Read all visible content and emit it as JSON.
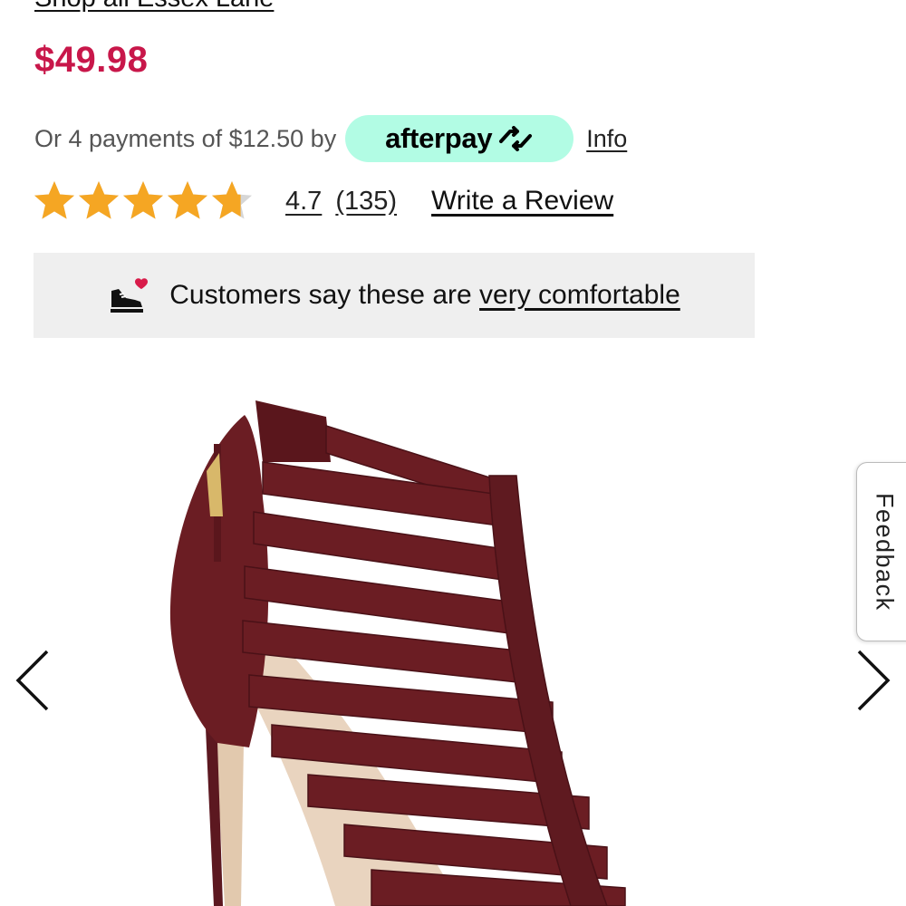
{
  "brand_link": "Shop all Essex Lane",
  "price": "$49.98",
  "payments": {
    "text": "Or 4 payments of $12.50 by",
    "provider": "afterpay",
    "info_label": "Info"
  },
  "rating": {
    "stars_out_of_5": 4.7,
    "value": "4.7",
    "count": "(135)",
    "write_review_label": "Write a Review"
  },
  "comfort_banner": {
    "text": "Customers say these are ",
    "link_text": "very comfortable"
  },
  "feedback_label": "Feedback",
  "colors": {
    "price": "#c8174a",
    "afterpay_badge": "#b2fce4",
    "star": "#f5a623",
    "banner_bg": "#efefef",
    "product": "#6b1d23"
  },
  "icons": {
    "shoe_heart": "shoe-heart-icon",
    "prev": "chevron-left-icon",
    "next": "chevron-right-icon",
    "afterpay_logo": "afterpay-arrows-icon"
  }
}
